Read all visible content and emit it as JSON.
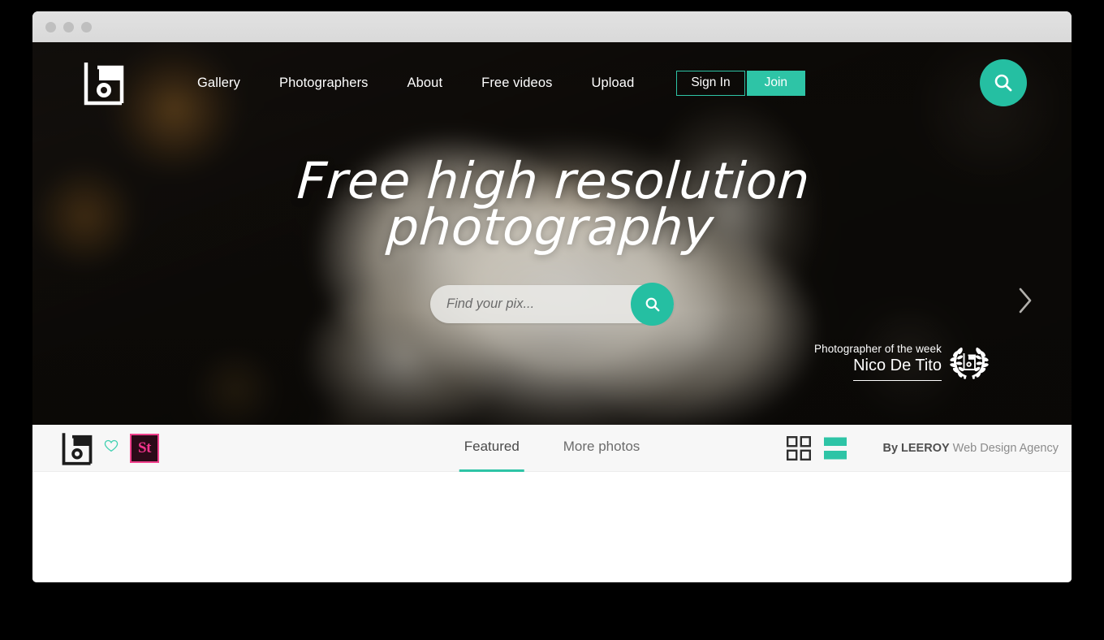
{
  "window": {
    "dots": [
      "close",
      "minimize",
      "maximize"
    ]
  },
  "colors": {
    "accent_teal": "#2ec4a6",
    "accent_teal_solid": "#25bfa2",
    "stock_pink": "#f2338c",
    "toolbar_bg": "#f7f7f7",
    "hero_dark": "#0c0a07"
  },
  "header": {
    "logo_name": "photo-logo",
    "nav": [
      {
        "label": "Gallery"
      },
      {
        "label": "Photographers"
      },
      {
        "label": "About"
      },
      {
        "label": "Free videos"
      },
      {
        "label": "Upload"
      }
    ],
    "sign_in_label": "Sign In",
    "join_label": "Join",
    "search_icon": "search-icon"
  },
  "hero": {
    "headline_line1": "Free high resolution",
    "headline_line2": "photography",
    "search": {
      "value": "",
      "placeholder": "Find your pix...",
      "submit_icon": "search-icon"
    },
    "next_slide_icon": "chevron-right-icon",
    "photographer_of_week": {
      "label": "Photographer of the week",
      "name": "Nico De Tito",
      "badge_icon": "laurel-wreath-icon"
    }
  },
  "toolbar": {
    "logo_name": "photo-logo-dark",
    "favorite_icon": "heart-icon",
    "stock_badge_label": "St",
    "tabs": [
      {
        "label": "Featured",
        "active": true
      },
      {
        "label": "More photos",
        "active": false
      }
    ],
    "views": [
      {
        "name": "grid-view",
        "active": false
      },
      {
        "name": "list-view",
        "active": true
      }
    ],
    "credit_prefix": "By LEEROY",
    "credit_suffix": " Web Design Agency"
  }
}
